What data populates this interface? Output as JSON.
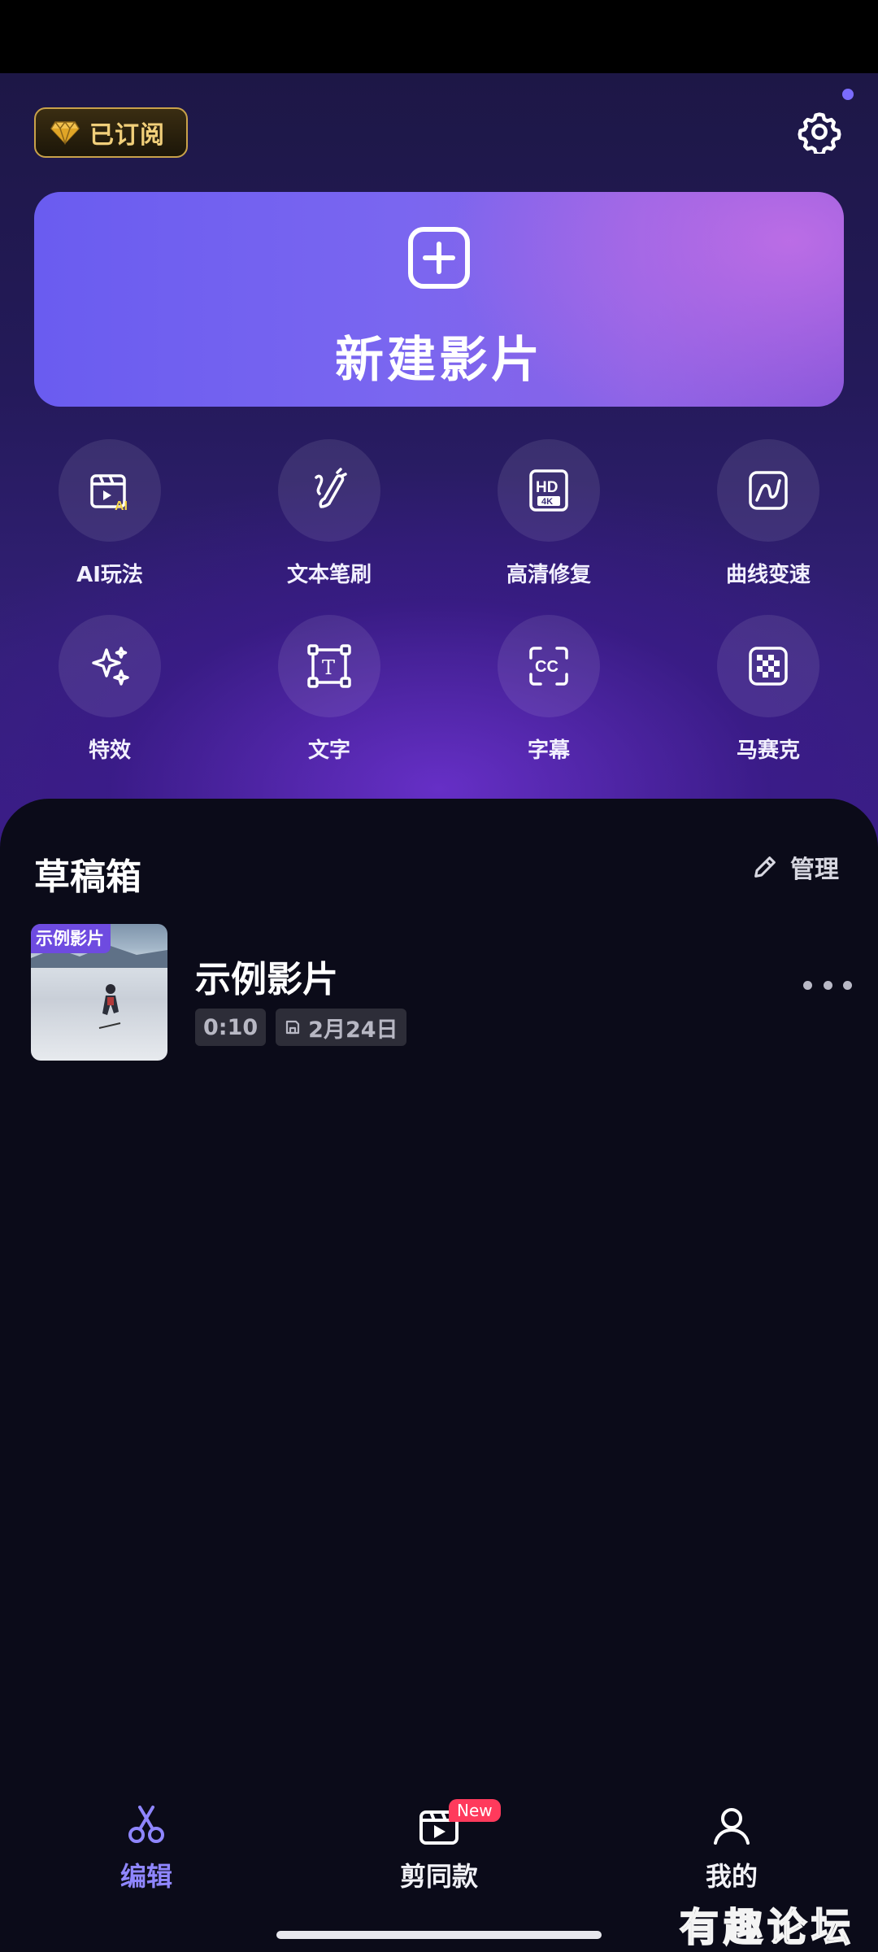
{
  "header": {
    "subscription_label": "已订阅",
    "settings_icon": "gear-icon",
    "accent_color": "#7b6cff"
  },
  "new_film": {
    "title": "新建影片",
    "icon": "plus-square-icon"
  },
  "tools": [
    {
      "label": "AI玩法",
      "icon": "ai-clapper-icon"
    },
    {
      "label": "文本笔刷",
      "icon": "brush-icon"
    },
    {
      "label": "高清修复",
      "icon": "hd-4k-icon"
    },
    {
      "label": "曲线变速",
      "icon": "curve-speed-icon"
    },
    {
      "label": "特效",
      "icon": "sparkle-icon"
    },
    {
      "label": "文字",
      "icon": "text-box-icon"
    },
    {
      "label": "字幕",
      "icon": "caption-cc-icon"
    },
    {
      "label": "马赛克",
      "icon": "mosaic-icon"
    }
  ],
  "drafts": {
    "title": "草稿箱",
    "manage_label": "管理",
    "items": [
      {
        "thumb_tag": "示例影片",
        "name": "示例影片",
        "duration": "0:10",
        "date": "2月24日"
      }
    ]
  },
  "tabbar": {
    "tabs": [
      {
        "label": "编辑",
        "icon": "scissors-icon",
        "active": true
      },
      {
        "label": "剪同款",
        "icon": "template-video-icon",
        "badge": "New"
      },
      {
        "label": "我的",
        "icon": "profile-icon"
      }
    ],
    "active_color": "#8f86ff",
    "badge_color": "#ff3a5c"
  },
  "watermark": "有趣论坛"
}
